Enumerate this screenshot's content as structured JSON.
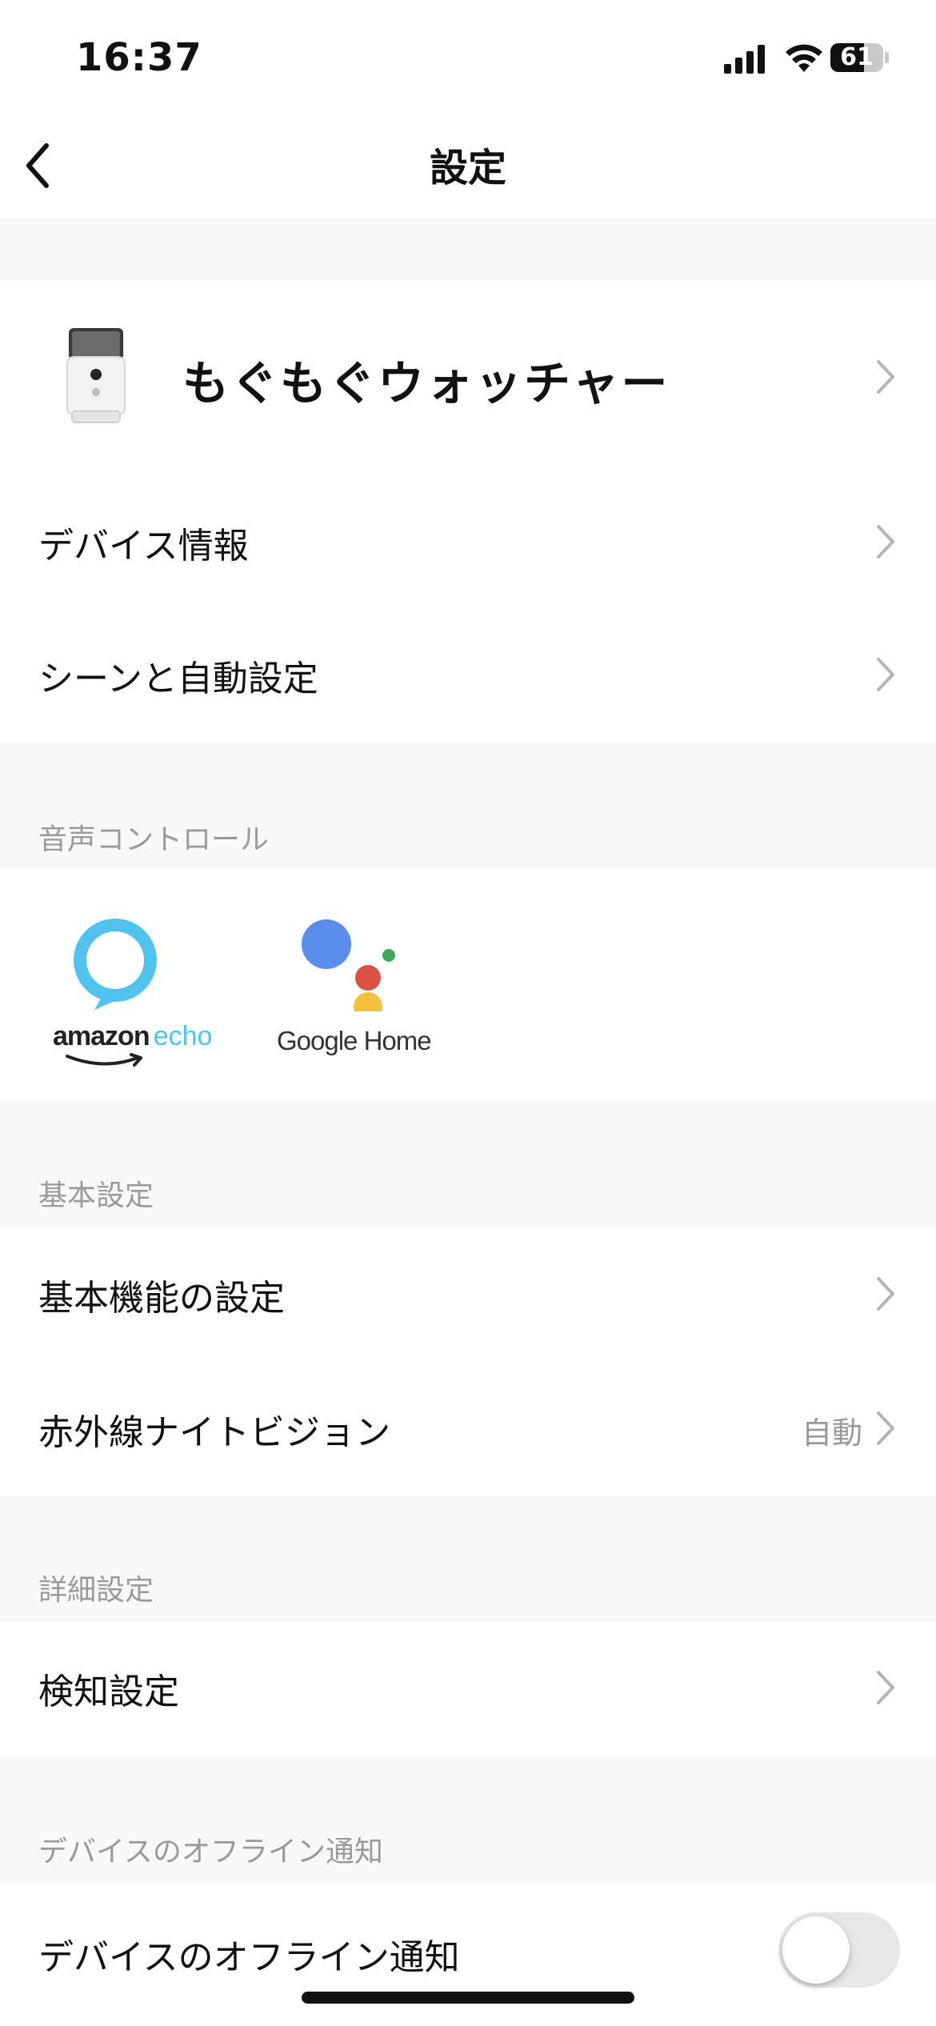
{
  "status_bar": {
    "time": "16:37",
    "battery": "61"
  },
  "header": {
    "title": "設定"
  },
  "device": {
    "name": "もぐもぐウォッチャー"
  },
  "top_items": [
    {
      "label": "デバイス情報"
    },
    {
      "label": "シーンと自動設定"
    }
  ],
  "voice_control": {
    "section_title": "音声コントロール",
    "services": [
      {
        "name_part1": "amazon",
        "name_part2": "echo",
        "icon": "alexa-ring-icon"
      },
      {
        "name": "Google Home",
        "icon": "google-assistant-icon"
      }
    ]
  },
  "basic": {
    "section_title": "基本設定",
    "items": [
      {
        "label": "基本機能の設定",
        "value": ""
      },
      {
        "label": "赤外線ナイトビジョン",
        "value": "自動"
      }
    ]
  },
  "advanced": {
    "section_title": "詳細設定",
    "items": [
      {
        "label": "検知設定"
      }
    ]
  },
  "offline": {
    "section_title": "デバイスのオフライン通知",
    "label": "デバイスのオフライン通知",
    "enabled": false
  },
  "colors": {
    "accent_echo": "#4fc3ee",
    "google_blue": "#5b8def",
    "google_red": "#dd5144",
    "google_yellow": "#f4c13e",
    "google_green": "#3fa95a"
  }
}
